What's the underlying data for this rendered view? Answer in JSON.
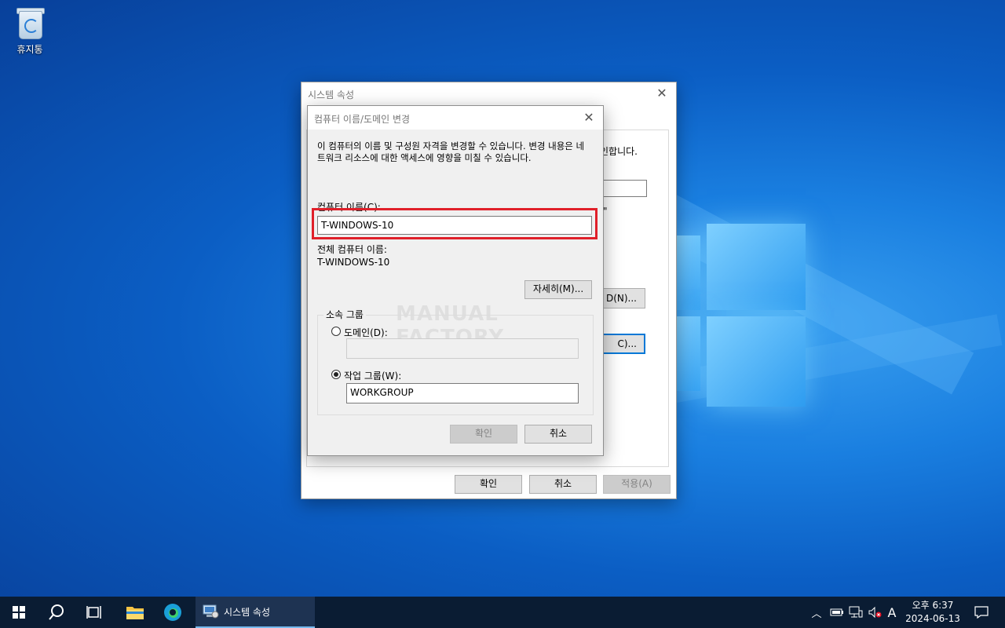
{
  "desktop": {
    "recycle_bin_label": "휴지통",
    "watermark": "MANUAL FACTORY"
  },
  "system_properties": {
    "title": "시스템 속성",
    "partial_text_1": "인합니다.",
    "partial_text_2": "\"",
    "partial_button_1": "D(N)...",
    "partial_button_2": "C)...",
    "ok_label": "확인",
    "cancel_label": "취소",
    "apply_label": "적용(A)"
  },
  "rename_dialog": {
    "title": "컴퓨터 이름/도메인 변경",
    "description": "이 컴퓨터의 이름 및 구성원 자격을 변경할 수 있습니다. 변경 내용은 네트워크 리소스에 대한 액세스에 영향을 미칠 수 있습니다.",
    "computer_name_label": "컴퓨터 이름(C):",
    "computer_name_value": "T-WINDOWS-10",
    "full_name_label": "전체 컴퓨터 이름:",
    "full_name_value": "T-WINDOWS-10",
    "more_button": "자세히(M)...",
    "member_of_label": "소속 그룹",
    "domain_label": "도메인(D):",
    "domain_value": "",
    "workgroup_label": "작업 그룹(W):",
    "workgroup_value": "WORKGROUP",
    "ok_label": "확인",
    "cancel_label": "취소",
    "highlight_color": "#e0202a"
  },
  "taskbar": {
    "active_window_label": "시스템 속성",
    "ime_indicator": "A",
    "time": "오후 6:37",
    "date": "2024-06-13"
  }
}
